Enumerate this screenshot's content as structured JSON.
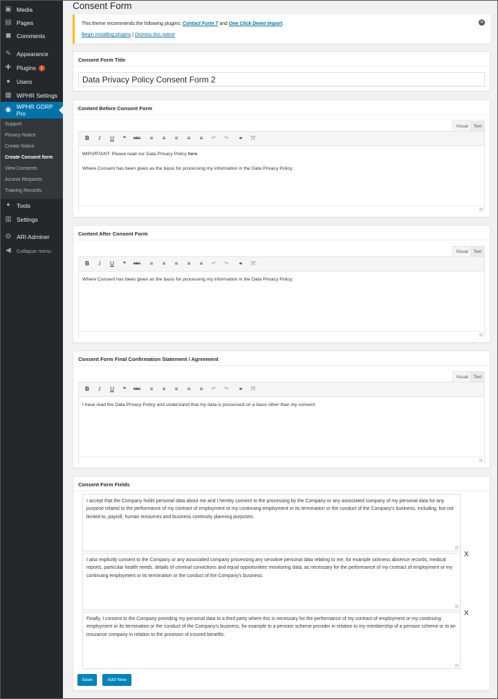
{
  "sidebar": {
    "top_items": [
      {
        "label": "Media",
        "icon": "media-icon"
      },
      {
        "label": "Pages",
        "icon": "pages-icon"
      },
      {
        "label": "Comments",
        "icon": "comments-icon"
      },
      {
        "label": "Appearance",
        "icon": "appearance-icon"
      },
      {
        "label": "Plugins",
        "icon": "plugins-icon",
        "badge": "1"
      },
      {
        "label": "Users",
        "icon": "users-icon"
      },
      {
        "label": "WPHR Settings",
        "icon": "settings-icon"
      },
      {
        "label": "WPHR GDRP Pro",
        "icon": "eye-icon"
      }
    ],
    "submenu": [
      "Support",
      "Privacy Notice",
      "Create Notice",
      "Create Consent form",
      "View Consents",
      "Access Requests",
      "Training Records"
    ],
    "bottom_items": [
      {
        "label": "Tools",
        "icon": "tools-icon"
      },
      {
        "label": "Settings",
        "icon": "sliders-icon"
      },
      {
        "label": "ARI Adminer",
        "icon": "gear-icon"
      },
      {
        "label": "Collapse menu",
        "icon": "collapse-icon"
      }
    ]
  },
  "page": {
    "title": "Consent Form"
  },
  "notice": {
    "text_before": "This theme recommends the following plugins: ",
    "plugin1": "Contact Form 7",
    "text_and": " and ",
    "plugin2": "One Click Demo Import",
    "text_after": ".",
    "install_link": "Begin installing plugins",
    "separator": " | ",
    "dismiss_link": "Dismiss this notice",
    "dismiss_icon": "close-icon"
  },
  "title_box": {
    "label": "Consent Form Title",
    "value": "Data Privacy Policy Consent Form 2"
  },
  "editor_tabs": {
    "visual": "Visual",
    "text": "Text"
  },
  "toolbar": {
    "bold": "B",
    "italic": "I",
    "underline": "U",
    "quote": "❝",
    "strike": "ABC",
    "ul": "≡",
    "ol": "≡",
    "align_left": "≡",
    "align_center": "≡",
    "align_right": "≡",
    "undo": "↶",
    "redo": "↷",
    "link": "⚭",
    "fullscreen": "⤧"
  },
  "before": {
    "label": "Content Before Consent Form",
    "line1_prefix": "IMPORTANT: Please read our Data Privacy Policy ",
    "line1_link": "here",
    "line1_suffix": ".",
    "line2": "Where Consent has been given as the basis for processing my information in the Data Privacy Policy:"
  },
  "after": {
    "label": "Content After Consent Form",
    "line1": "Where Consent has been given as the basis for processing my information in the Data Privacy Policy:"
  },
  "final": {
    "label": "Consent Form Final Confirmation Statement / Agreement",
    "line1": "I have read the Data Privacy Policy and understand that my data is processed on a basis other than my consent."
  },
  "fields": {
    "label": "Consent Form Fields",
    "items": [
      "I accept that the Company holds personal data about me and I hereby consent to the processing by the Company or any associated company of my personal data for any purpose related to the performance of my contract of employment or my continuing employment or its termination or the conduct of the Company's business, including, but not limited to, payroll, human resources and business continuity planning purposes.",
      "I also explicitly consent to the Company or any associated company processing any sensitive personal data relating to me, for example sickness absence records, medical reports, particular health needs, details of criminal convictions and equal opportunities monitoring data, as necessary for the performance of my contract of employment or my continuing employment or its termination or the conduct of the Company's business.",
      "Finally, I consent to the Company providing my personal data to a third party where this is necessary for the performance of my contract of employment or my continuing employment or its termination or the conduct of the Company's business, for example to a pension scheme provider in relation to my membership of a pension scheme or to an insurance company in relation to the provision of insured benefits."
    ],
    "remove_label": "X"
  },
  "buttons": {
    "save": "Save",
    "add_new": "Add New"
  },
  "colors": {
    "sidebar": "#23282d",
    "active": "#0073aa",
    "notice_border": "#ffb900",
    "button": "#0085ba",
    "badge": "#d54e21"
  }
}
